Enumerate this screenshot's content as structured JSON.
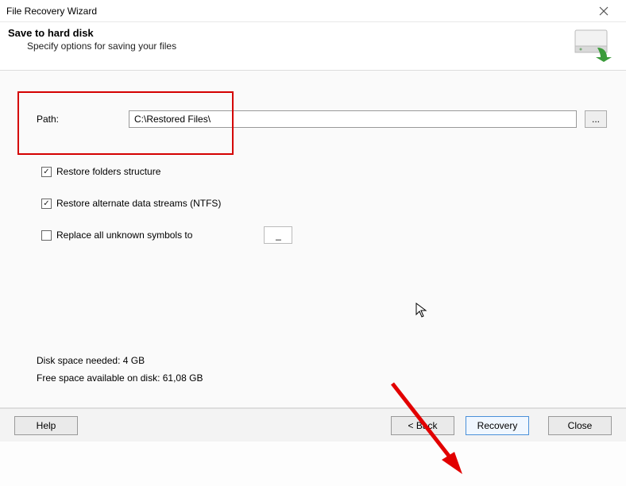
{
  "window": {
    "title": "File Recovery Wizard"
  },
  "header": {
    "title": "Save to hard disk",
    "subtitle": "Specify options for saving your files"
  },
  "path": {
    "label": "Path:",
    "value": "C:\\Restored Files\\",
    "browse_label": "..."
  },
  "options": {
    "restore_structure": {
      "label": "Restore folders structure",
      "checked": true
    },
    "restore_ads": {
      "label": "Restore alternate data streams (NTFS)",
      "checked": true
    },
    "replace_symbols": {
      "label": "Replace all unknown symbols to",
      "checked": false,
      "value": "_"
    }
  },
  "info": {
    "needed": "Disk space needed: 4 GB",
    "free": "Free space available on disk: 61,08 GB"
  },
  "footer": {
    "help": "Help",
    "back": "< Back",
    "recovery": "Recovery",
    "close": "Close"
  }
}
